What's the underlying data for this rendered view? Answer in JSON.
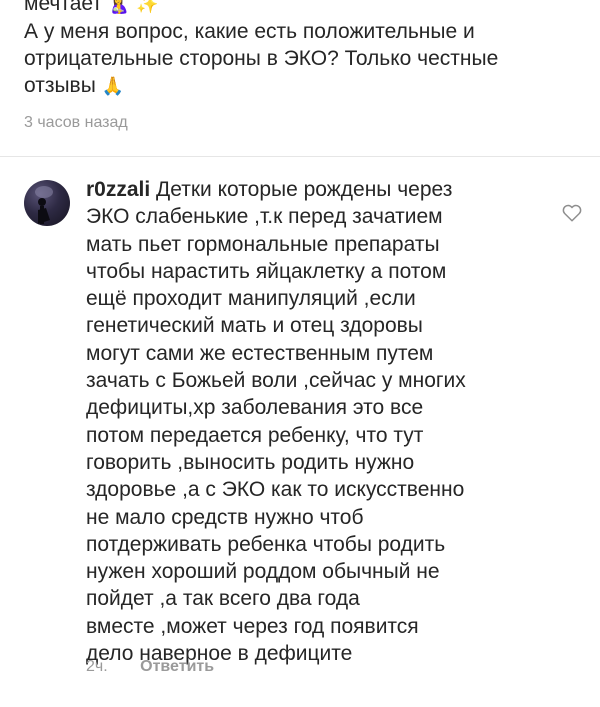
{
  "previous_comment": {
    "first_line": "мечтает",
    "first_line_emoji": "🤱 ✨",
    "text": "А у меня вопрос, какие есть положительные и\nотрицательные стороны в ЭКО? Только честные\nотзывы",
    "text_emoji": "🙏",
    "time": "3 часов назад"
  },
  "comment": {
    "username": "r0zzali",
    "text": "Детки которые рождены через\nЭКО слабенькие ,т.к перед зачатием\nмать пьет гормональные препараты\nчтобы нарастить яйцаклетку а потом\nещё проходит манипуляций ,если\nгенетический мать и отец здоровы\nмогут сами же естественным путем\nзачать с Божьей воли ,сейчас у многих\nдефициты,хр заболевания это все\nпотом передается ребенку, что тут\nговорить ,выносить родить нужно\nздоровье ,а с ЭКО как то искусственно\nне мало средств нужно чтоб\nпотдерживать ребенка чтобы родить\nнужен хороший роддом обычный не\nпойдет ,а так всего два года\nвместе ,может через год появится\nдело наверное в дефиците",
    "time": "2ч.",
    "reply_label": "Ответить",
    "like_icon": "heart-outline-icon",
    "avatar_icon": "avatar"
  },
  "colors": {
    "text": "#262626",
    "meta": "#9a9a9a",
    "divider": "#e6e6e6"
  }
}
